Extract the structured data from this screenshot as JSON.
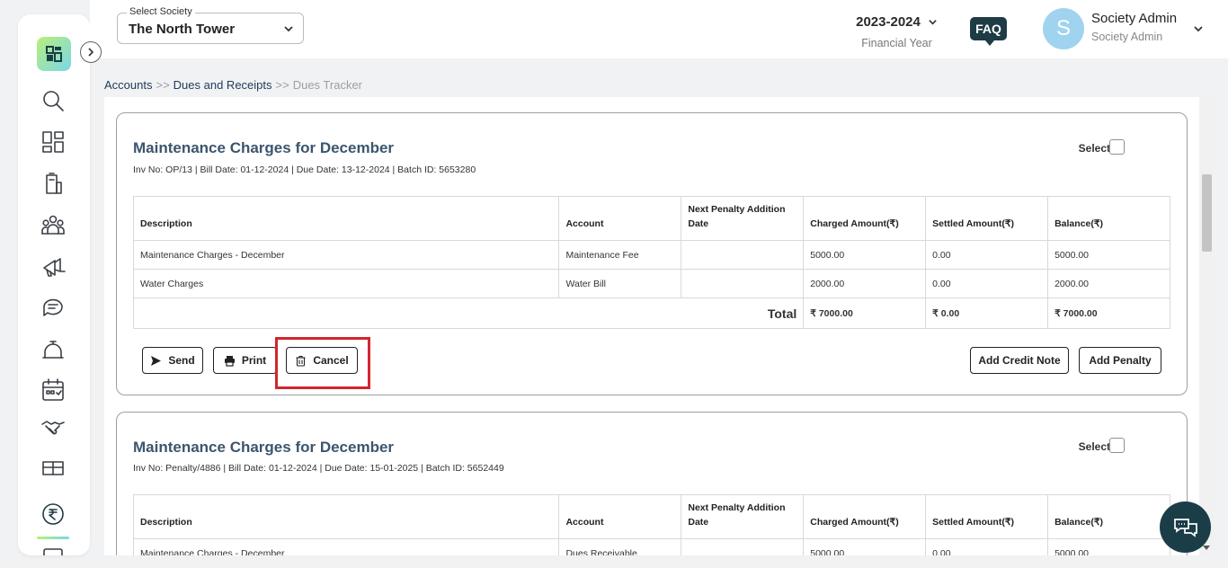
{
  "header": {
    "society_label": "Select Society",
    "society_value": "The North Tower",
    "financial_year": "2023-2024",
    "financial_year_label": "Financial Year",
    "faq": "FAQ",
    "avatar_initial": "S",
    "user_name": "Society Admin",
    "user_role": "Society Admin"
  },
  "breadcrumb": {
    "level1": "Accounts",
    "level2": "Dues and Receipts",
    "level3": "Dues Tracker",
    "separator": ">>"
  },
  "columns": [
    "Description",
    "Account",
    "Next Penalty Addition Date",
    "Charged Amount(₹)",
    "Settled Amount(₹)",
    "Balance(₹)"
  ],
  "cards": [
    {
      "title": "Maintenance Charges for December",
      "subtitle": "Inv No: OP/13 | Bill Date: 01-12-2024 | Due Date: 13-12-2024 | Batch ID: 5653280",
      "select_label": "Select",
      "rows": [
        {
          "description": "Maintenance Charges - December",
          "account": "Maintenance Fee",
          "next_penalty": "",
          "charged": "5000.00",
          "settled": "0.00",
          "balance": "5000.00"
        },
        {
          "description": "Water Charges",
          "account": "Water Bill",
          "next_penalty": "",
          "charged": "2000.00",
          "settled": "0.00",
          "balance": "2000.00"
        }
      ],
      "total_label": "Total",
      "total_charged": "₹ 7000.00",
      "total_settled": "₹ 0.00",
      "total_balance": "₹ 7000.00",
      "buttons": {
        "send": "Send",
        "print": "Print",
        "cancel": "Cancel",
        "add_credit_note": "Add Credit Note",
        "add_penalty": "Add Penalty"
      }
    },
    {
      "title": "Maintenance Charges for December",
      "subtitle": "Inv No: Penalty/4886 | Bill Date: 01-12-2024 | Due Date: 15-01-2025 | Batch ID: 5652449",
      "select_label": "Select",
      "rows": [
        {
          "description": "Maintenance Charges - December",
          "account": "Dues Receivable",
          "next_penalty": "",
          "charged": "5000.00",
          "settled": "0.00",
          "balance": "5000.00"
        }
      ]
    }
  ],
  "colors": {
    "accent_dark": "#1b3d48",
    "title_blue": "#3b556e",
    "highlight_red": "#d2262e"
  }
}
